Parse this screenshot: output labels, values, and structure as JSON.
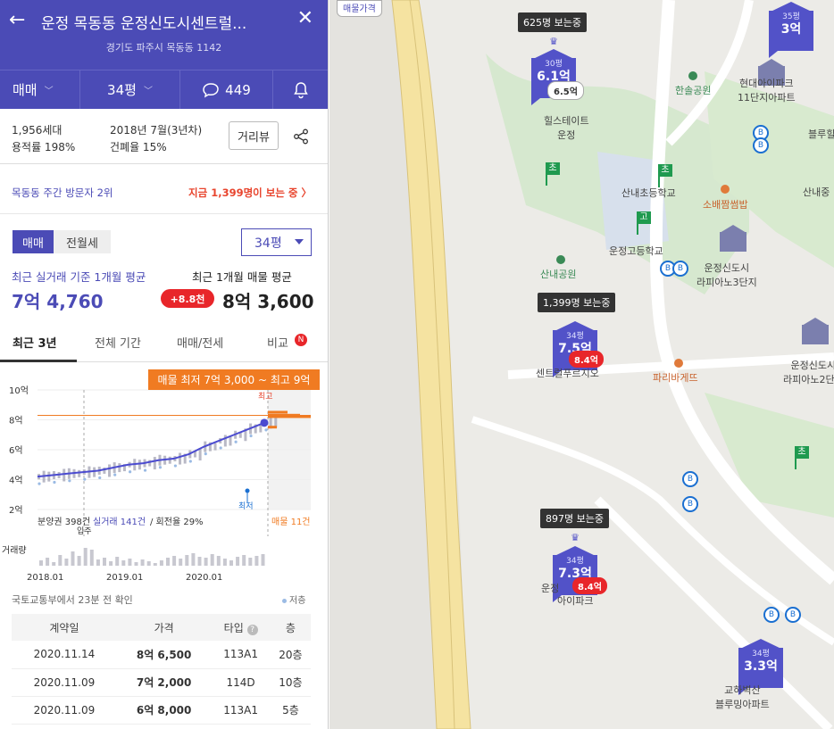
{
  "header": {
    "title": "운정 목동동 운정신도시센트럴...",
    "address": "경기도 파주시 목동동 1142",
    "deal_type": "매매",
    "size": "34평",
    "comments": "449"
  },
  "info": {
    "households": "1,956세대",
    "floor_area_ratio": "용적률 198%",
    "built": "2018년 7월(3년차)",
    "building_coverage": "건폐율 15%",
    "street_view_button": "거리뷰"
  },
  "ranking": {
    "left": "목동동 주간 방문자 2위",
    "right": "지금 1,399명이 보는 중 〉"
  },
  "price_panel": {
    "toggle_sale": "매매",
    "toggle_rent": "전월세",
    "size_select": "34평",
    "recent_label": "최근 실거래 기준 1개월 평균",
    "listing_label": "최근 1개월 매물 평균",
    "recent_value": "7억 4,760",
    "diff": "+8.8천",
    "listing_value": "8억 3,600"
  },
  "tabs": [
    "최근 3년",
    "전체 기간",
    "매매/전세",
    "비교"
  ],
  "tabs_badge": "N",
  "chart_data": {
    "type": "line",
    "ylabels": [
      "10억",
      "8억",
      "6억",
      "4억",
      "2억"
    ],
    "ylim": [
      2,
      10
    ],
    "x": [
      "2018.01",
      "2019.01",
      "2020.01"
    ],
    "series": [
      {
        "values": [
          4.2,
          4.3,
          4.4,
          4.5,
          4.6,
          4.8,
          5.0,
          5.1,
          5.3,
          5.4,
          5.7,
          6.2,
          6.6,
          7.0,
          7.4,
          7.8
        ]
      }
    ],
    "listing_range": "매물 최저 7억 3,000 ~ 최고 9억",
    "max_label": "최고",
    "min_label": "최저",
    "footer_presale": "분양권 398건",
    "footer_deals": "실거래 141건",
    "footer_turnover": " / 회전율 29%",
    "footer_listings": "매물 11건",
    "move_in": "입주",
    "volume_label": "거래량"
  },
  "source": "국토교통부에서 23분 전 확인",
  "legend_low": "저층",
  "table": {
    "headers": [
      "계약일",
      "가격",
      "타입",
      "층"
    ],
    "type_help": "?",
    "rows": [
      [
        "2020.11.14",
        "8억 6,500",
        "113A1",
        "20층"
      ],
      [
        "2020.11.09",
        "7억 2,000",
        "114D",
        "10층"
      ],
      [
        "2020.11.09",
        "6억 8,000",
        "113A1",
        "5층"
      ]
    ]
  },
  "map": {
    "map_type": "매물가격",
    "viewers": [
      "625명 보는중",
      "1,399명 보는중",
      "897명 보는중"
    ],
    "markers": [
      {
        "size": "30평",
        "price": "6.1억",
        "badge": "6.5억"
      },
      {
        "size": "34평",
        "price": "7.5억",
        "badge": "8.4억"
      },
      {
        "size": "34평",
        "price": "7.3억",
        "badge": "8.4억"
      },
      {
        "size": "35평",
        "price": "3억"
      },
      {
        "size": "34평",
        "price": "3.3억"
      }
    ],
    "labels": {
      "hillstate": "힐스테이트\n운정",
      "hansol": "한솔공원",
      "hyundai": "현대아이파크\n11단지아파트",
      "blue": "블루힐",
      "sannae_ch": "산내초등학교",
      "sonae": "소배짬썸밥",
      "unjeong_h": "운정고등학교",
      "sannae_park": "산내공원",
      "lafia3": "운정신도시\n라피아노3단지",
      "sannae_j": "산내중",
      "central": "센트럴푸르지오",
      "paris": "파리바게뜨",
      "lafia2": "운정신도시\n라피아노2단지",
      "ipark": "아이파크",
      "unjeong2": "운정",
      "blueming": "교하벽산\n블루밍아파트"
    },
    "flags": [
      "초",
      "초",
      "고",
      "초"
    ]
  }
}
